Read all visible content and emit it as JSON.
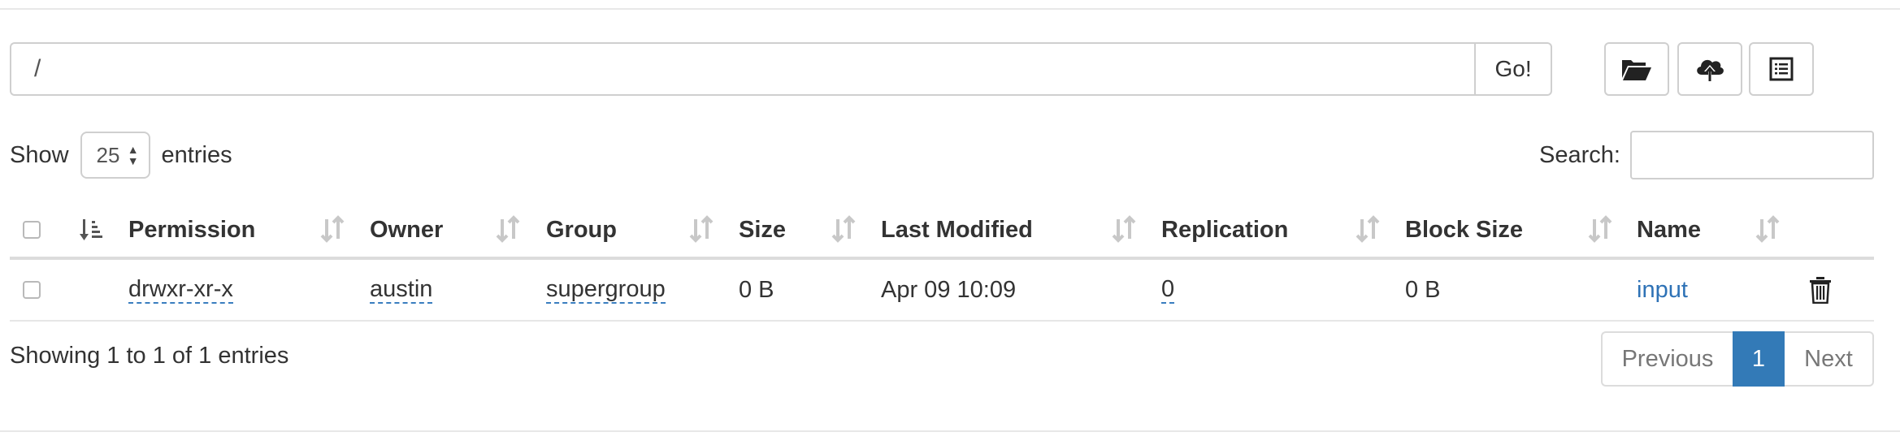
{
  "browser": {
    "path_value": "/",
    "go_label": "Go!",
    "toolbar_icons": [
      "folder-open-icon",
      "cloud-upload-icon",
      "list-icon"
    ]
  },
  "length": {
    "prefix": "Show",
    "value": "25",
    "suffix": "entries"
  },
  "search": {
    "label": "Search:",
    "value": ""
  },
  "table": {
    "columns": [
      "Permission",
      "Owner",
      "Group",
      "Size",
      "Last Modified",
      "Replication",
      "Block Size",
      "Name"
    ],
    "rows": [
      {
        "permission": "drwxr-xr-x",
        "owner": "austin",
        "group": "supergroup",
        "size": "0 B",
        "modified": "Apr 09 10:09",
        "replication": "0",
        "block_size": "0 B",
        "name": "input"
      }
    ]
  },
  "info": "Showing 1 to 1 of 1 entries",
  "pagination": {
    "previous": "Previous",
    "current": "1",
    "next": "Next"
  },
  "colors": {
    "accent": "#337ab7",
    "link": "#2e72b6"
  }
}
